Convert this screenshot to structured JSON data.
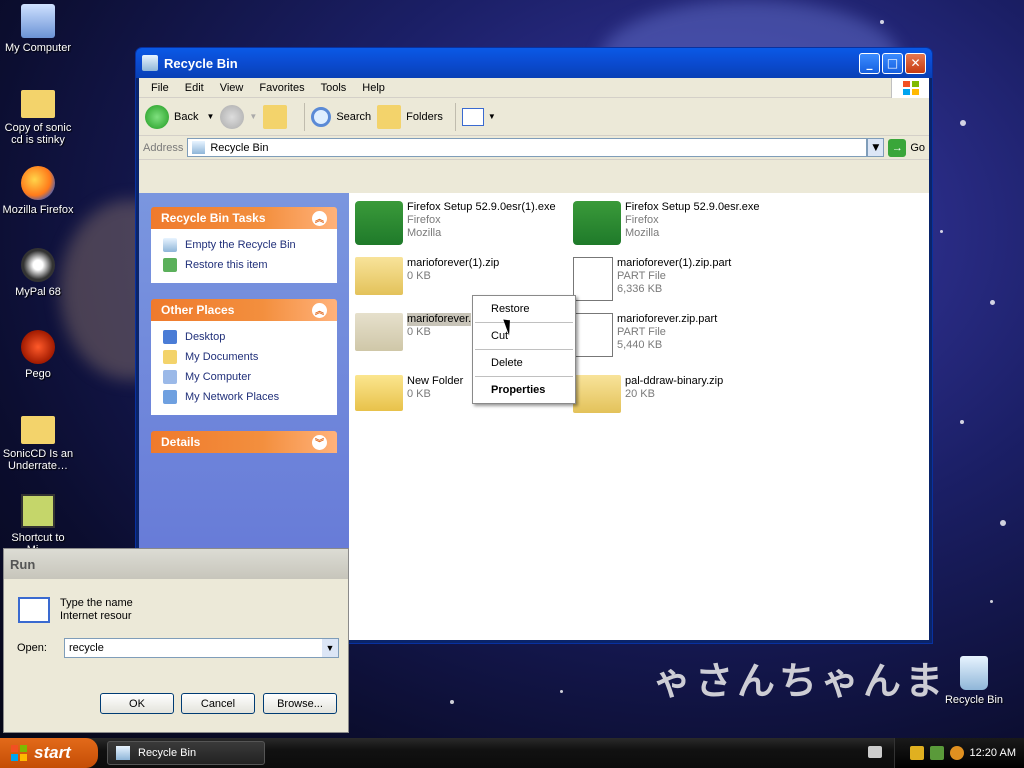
{
  "desktop": {
    "icons": [
      {
        "label": "My Computer",
        "icon": "computer-icon"
      },
      {
        "label": "Copy of sonic cd is stinky",
        "icon": "folder-icon"
      },
      {
        "label": "Mozilla Firefox",
        "icon": "firefox-icon"
      },
      {
        "label": "MyPal 68",
        "icon": "mypal-icon"
      },
      {
        "label": "Pego",
        "icon": "pego-icon"
      },
      {
        "label": "SonicCD Is an Underrate…",
        "icon": "folder-icon"
      },
      {
        "label": "Shortcut to Mi…",
        "icon": "shortcut-icon"
      }
    ],
    "recycle_label": "Recycle Bin",
    "watermark": "ゃさんちゃんま"
  },
  "window": {
    "title": "Recycle Bin",
    "menu": [
      "File",
      "Edit",
      "View",
      "Favorites",
      "Tools",
      "Help"
    ],
    "toolbar": {
      "back": "Back",
      "search": "Search",
      "folders": "Folders"
    },
    "address_label": "Address",
    "address_value": "Recycle Bin",
    "go": "Go"
  },
  "tasks_panel": {
    "title": "Recycle Bin Tasks",
    "items": [
      "Empty the Recycle Bin",
      "Restore this item"
    ]
  },
  "places_panel": {
    "title": "Other Places",
    "items": [
      "Desktop",
      "My Documents",
      "My Computer",
      "My Network Places"
    ]
  },
  "details_panel": {
    "title": "Details"
  },
  "files": [
    {
      "name": "Firefox Setup 52.9.0esr(1).exe",
      "line2": "Firefox",
      "line3": "Mozilla",
      "icon": "firefox-setup-icon"
    },
    {
      "name": "Firefox Setup 52.9.0esr.exe",
      "line2": "Firefox",
      "line3": "Mozilla",
      "icon": "firefox-setup-icon"
    },
    {
      "name": "marioforever(1).zip",
      "line2": "0 KB",
      "icon": "zip-folder-icon"
    },
    {
      "name": "marioforever(1).zip.part",
      "line2": "PART File",
      "line3": "6,336 KB",
      "icon": "part-file-icon"
    },
    {
      "name": "marioforever.",
      "line2": "0 KB",
      "icon": "zip-folder-icon"
    },
    {
      "name": "marioforever.zip.part",
      "line2": "PART File",
      "line3": "5,440 KB",
      "icon": "part-file-icon"
    },
    {
      "name": "New Folder",
      "line2": "0 KB",
      "icon": "folder-icon"
    },
    {
      "name": "pal-ddraw-binary.zip",
      "line2": "20 KB",
      "icon": "zip-folder-icon"
    }
  ],
  "context_menu": [
    "Restore",
    "Cut",
    "Delete",
    "Properties"
  ],
  "run_dialog": {
    "title": "Run",
    "description": "Type the name Internet resour",
    "open_label": "Open:",
    "open_value": "recycle",
    "ok": "OK",
    "cancel": "Cancel",
    "browse": "Browse..."
  },
  "taskbar": {
    "start": "start",
    "task": "Recycle Bin",
    "clock": "12:20 AM"
  }
}
